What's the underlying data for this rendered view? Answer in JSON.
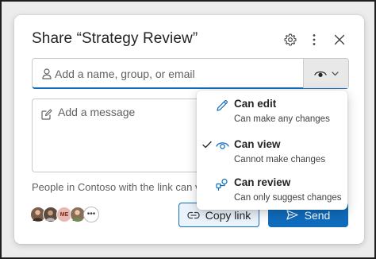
{
  "dialog": {
    "title": "Share “Strategy Review”",
    "header_icons": [
      "gear-icon",
      "more-vertical-icon",
      "close-icon"
    ]
  },
  "recipients": {
    "placeholder": "Add a name, group, or email",
    "icon": "person-icon",
    "permission_icon": "eye-icon"
  },
  "message": {
    "placeholder": "Add a message",
    "icon": "compose-icon"
  },
  "link_info": "People in Contoso with the link can v",
  "avatars": [
    {
      "kind": "photo",
      "color": "#7a5a4a"
    },
    {
      "kind": "photo",
      "color": "#5d4a3f"
    },
    {
      "kind": "initials",
      "initials": "ME"
    },
    {
      "kind": "photo",
      "color": "#8a6e5a"
    },
    {
      "kind": "more",
      "label": "•••"
    }
  ],
  "buttons": {
    "copy_link": "Copy link",
    "send": "Send"
  },
  "permission_menu": {
    "selected": "Can view",
    "items": [
      {
        "title": "Can edit",
        "description": "Can make any changes",
        "icon": "pencil-icon",
        "checked": false
      },
      {
        "title": "Can view",
        "description": "Cannot make changes",
        "icon": "eye-icon",
        "checked": true
      },
      {
        "title": "Can review",
        "description": "Can only suggest changes",
        "icon": "review-icon",
        "checked": false
      }
    ]
  },
  "colors": {
    "accent": "#0f6cbd",
    "accent_light": "#ebf3fc",
    "text": "#242424",
    "muted": "#616161"
  }
}
